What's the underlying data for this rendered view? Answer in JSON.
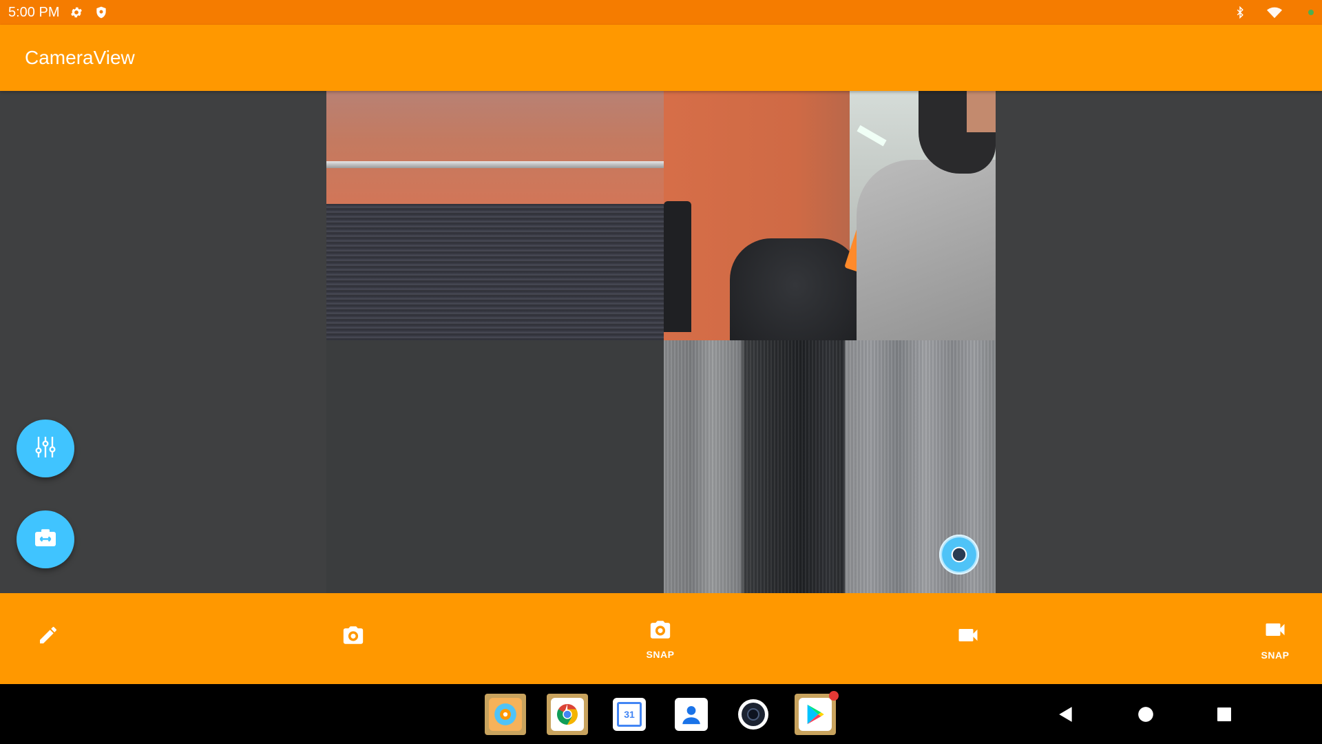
{
  "status_bar": {
    "time": "5:00 PM",
    "left_icons": [
      "gear-icon",
      "shield-icon"
    ],
    "right_icons": [
      "bluetooth-icon",
      "wifi-icon"
    ]
  },
  "app_bar": {
    "title": "CameraView"
  },
  "preview": {
    "watermark": "cameraview-logo"
  },
  "fabs": [
    {
      "name": "filters-button",
      "icon": "sliders-icon"
    },
    {
      "name": "switch-camera-button",
      "icon": "switch-camera-icon"
    }
  ],
  "bottom_bar": {
    "edit": {
      "icon": "pencil-icon",
      "label": ""
    },
    "capture_picture": {
      "icon": "camera-icon",
      "label": ""
    },
    "capture_picture_snapshot": {
      "icon": "camera-icon",
      "label": "SNAP"
    },
    "capture_video": {
      "icon": "videocam-icon",
      "label": ""
    },
    "capture_video_snapshot": {
      "icon": "videocam-icon",
      "label": "SNAP"
    }
  },
  "taskbar": {
    "apps": [
      "cameraview-app",
      "chrome-app",
      "calendar-app",
      "contacts-app",
      "camera-app",
      "play-store-app"
    ],
    "calendar_day": "31"
  },
  "colors": {
    "status_bar": "#f57c00",
    "app_bar": "#ff9800",
    "fab": "#40c4ff",
    "background": "#3f4041"
  }
}
